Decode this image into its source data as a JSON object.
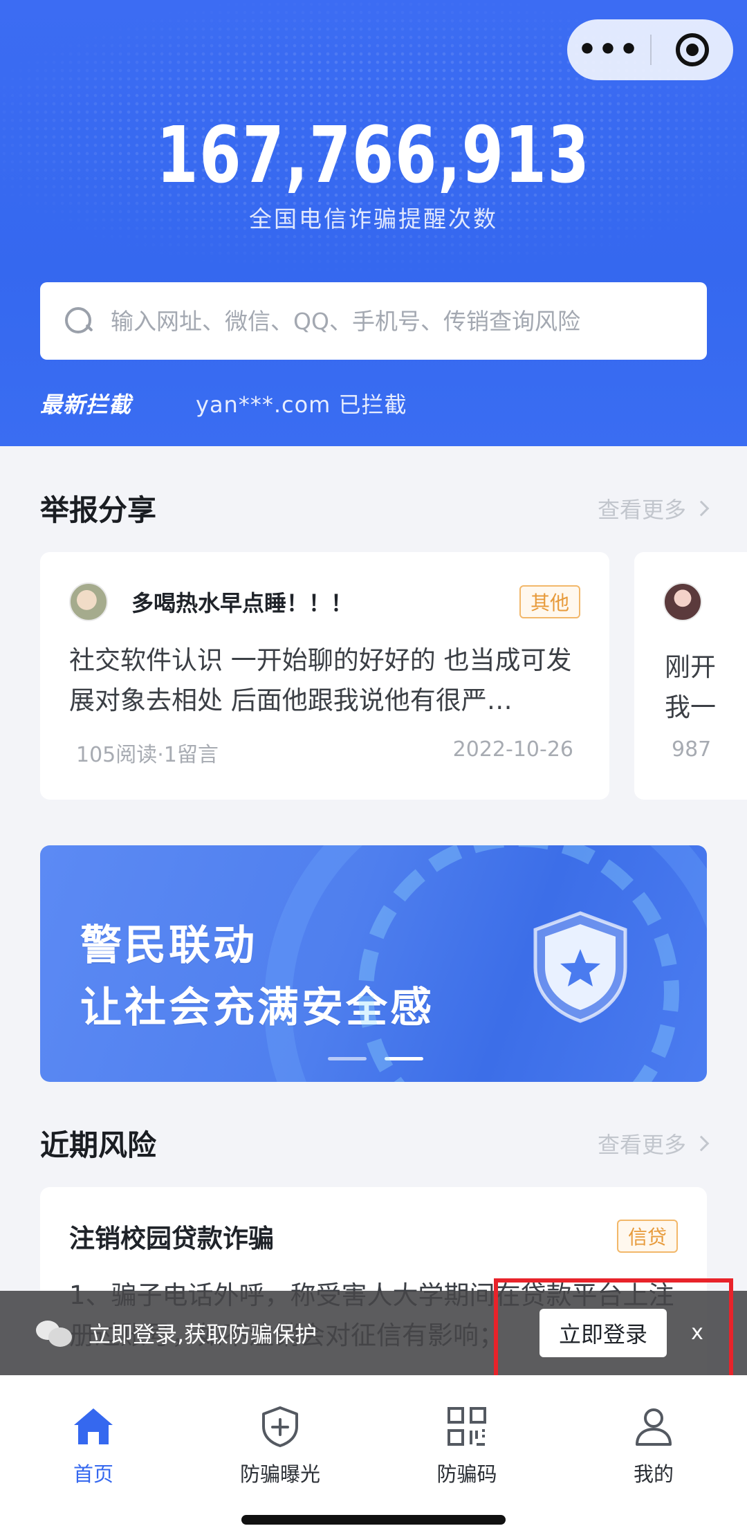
{
  "capsule": {
    "more_glyph": "•••",
    "target_icon": "target-circle"
  },
  "hero": {
    "counter": "167,766,913",
    "counter_label": "全国电信诈骗提醒次数",
    "search_placeholder": "输入网址、微信、QQ、手机号、传销查询风险",
    "latest_tag": "最新拦截",
    "latest_value": "yan***.com 已拦截"
  },
  "reports": {
    "title": "举报分享",
    "more": "查看更多",
    "cards": [
      {
        "author": "多喝热水早点睡！！！",
        "badge": "其他",
        "body": "社交软件认识 一开始聊的好好的 也当成可发展对象去相处 后面他跟我说他有很严…",
        "stats": "105阅读·1留言",
        "date": "2022-10-26"
      },
      {
        "line1": "刚开",
        "line2": "我一",
        "stats": "987"
      }
    ]
  },
  "banner": {
    "line1": "警民联动",
    "line2": "让社会充满安全感"
  },
  "risks": {
    "title": "近期风险",
    "more": "查看更多",
    "item": {
      "title": "注销校园贷款诈骗",
      "badge": "信贷",
      "body": "1、骗子电话外呼，称受害人大学期间在贷款平台上注册过账号，如不注销会对征信有影响；"
    }
  },
  "login_bar": {
    "text": "立即登录,获取防骗保护",
    "button": "立即登录",
    "close": "x"
  },
  "tabbar": {
    "tabs": [
      {
        "label": "首页",
        "icon": "home-icon",
        "active": true
      },
      {
        "label": "防骗曝光",
        "icon": "shield-plus-icon",
        "active": false
      },
      {
        "label": "防骗码",
        "icon": "qr-code-icon",
        "active": false
      },
      {
        "label": "我的",
        "icon": "user-icon",
        "active": false
      }
    ]
  },
  "colors": {
    "brand": "#3568ef",
    "badge": "#e79a3a",
    "highlight": "#e8232a"
  }
}
